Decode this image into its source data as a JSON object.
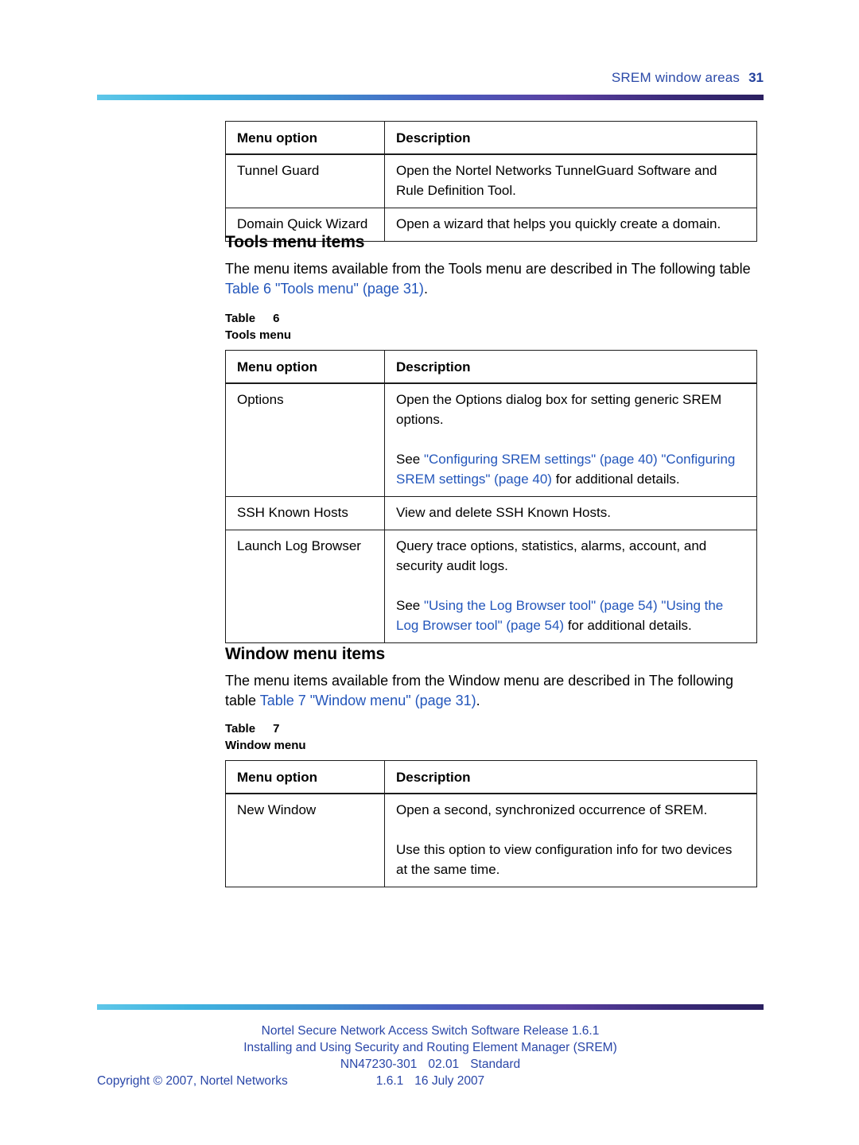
{
  "header": {
    "running_title": "SREM window areas",
    "page_number": "31",
    "accent_color": "#2b4aa8"
  },
  "tables": {
    "menu_option_header": "Menu option",
    "description_header": "Description",
    "top_table": {
      "rows": [
        {
          "option": "Tunnel Guard",
          "description": "Open the Nortel Networks TunnelGuard Software and Rule Definition Tool."
        },
        {
          "option": "Domain Quick Wizard",
          "description": "Open a wizard that helps you quickly create a domain."
        }
      ]
    },
    "tools_table": {
      "caption_label": "Table",
      "caption_number": "6",
      "caption_title": "Tools menu",
      "rows": [
        {
          "option": "Options",
          "description": "Open the Options dialog box for setting generic SREM options.",
          "see_prefix": "See ",
          "link_1": "\"Configuring SREM settings\" (page 40)",
          "link_2": "\"Configuring SREM settings\" (page 40)",
          "see_suffix": " for additional details."
        },
        {
          "option": "SSH Known Hosts",
          "description": "View and delete SSH Known Hosts."
        },
        {
          "option": "Launch Log Browser",
          "description": "Query trace options, statistics, alarms, account, and security audit logs.",
          "see_prefix": "See ",
          "link_1": "\"Using the Log Browser tool\" (page 54)",
          "link_2": "\"Using the Log Browser tool\" (page 54)",
          "see_suffix": " for additional details."
        }
      ]
    },
    "window_table": {
      "caption_label": "Table",
      "caption_number": "7",
      "caption_title": "Window menu",
      "rows": [
        {
          "option": "New Window",
          "description": "Open a second, synchronized occurrence of SREM.",
          "description_2": "Use this option to view configuration info for two devices at the same time."
        }
      ]
    }
  },
  "sections": {
    "tools": {
      "title": "Tools menu items",
      "intro_part_1": "The menu items available from the Tools menu are described in The following table ",
      "intro_link": "Table 6 \"Tools menu\" (page 31)",
      "intro_part_2": "."
    },
    "window": {
      "title": "Window menu items",
      "intro_part_1": "The menu items available from the Window menu are described in The following table ",
      "intro_link": "Table 7 \"Window menu\" (page 31)",
      "intro_part_2": "."
    }
  },
  "footer": {
    "line_1": "Nortel Secure Network Access Switch Software Release 1.6.1",
    "line_2": "Installing and Using Security and Routing Element Manager (SREM)",
    "line_3_doc": "NN47230-301",
    "line_3_issue": "02.01",
    "line_3_status": "Standard",
    "line_4_version": "1.6.1",
    "line_4_date": "16 July 2007",
    "copyright": "Copyright © 2007, Nortel Networks"
  }
}
